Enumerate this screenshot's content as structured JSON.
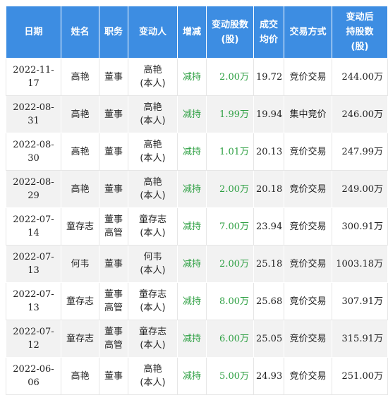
{
  "table": {
    "headers": [
      "日期",
      "姓名",
      "职务",
      "变动人",
      "增减",
      "变动股数\n(股)",
      "成交\n均价",
      "交易方式",
      "变动后\n持股数\n(股)"
    ],
    "rows": [
      [
        "2022-11-17",
        "高艳",
        "董事",
        "高艳\n(本人)",
        "减持",
        "2.00万",
        "19.72",
        "竞价交易",
        "244.00万"
      ],
      [
        "2022-08-31",
        "高艳",
        "董事",
        "高艳\n(本人)",
        "减持",
        "1.99万",
        "19.94",
        "集中竞价",
        "246.00万"
      ],
      [
        "2022-08-30",
        "高艳",
        "董事",
        "高艳\n(本人)",
        "减持",
        "1.01万",
        "20.13",
        "竞价交易",
        "247.99万"
      ],
      [
        "2022-08-29",
        "高艳",
        "董事",
        "高艳\n(本人)",
        "减持",
        "2.00万",
        "20.18",
        "竞价交易",
        "249.00万"
      ],
      [
        "2022-07-14",
        "童存志",
        "董事\n高管",
        "童存志\n(本人)",
        "减持",
        "7.00万",
        "23.94",
        "竞价交易",
        "300.91万"
      ],
      [
        "2022-07-13",
        "何韦",
        "董事",
        "何韦\n(本人)",
        "减持",
        "2.00万",
        "25.18",
        "竞价交易",
        "1003.18万"
      ],
      [
        "2022-07-13",
        "童存志",
        "董事\n高管",
        "童存志\n(本人)",
        "减持",
        "8.00万",
        "25.68",
        "竞价交易",
        "307.91万"
      ],
      [
        "2022-07-12",
        "童存志",
        "董事\n高管",
        "童存志\n(本人)",
        "减持",
        "6.00万",
        "25.05",
        "竞价交易",
        "315.91万"
      ],
      [
        "2022-06-06",
        "高艳",
        "董事",
        "高艳\n(本人)",
        "减持",
        "5.00万",
        "24.93",
        "竞价交易",
        "251.00万"
      ]
    ]
  },
  "colors": {
    "header_bg": "#3d8de2",
    "decrease_text": "#2ea043"
  }
}
